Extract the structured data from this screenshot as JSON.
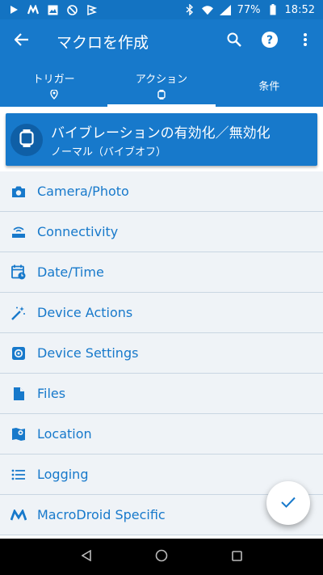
{
  "status_bar": {
    "battery": "77%",
    "time": "18:52",
    "icons_left": [
      "play-icon",
      "macrodroid-icon",
      "image-icon",
      "dnd-icon",
      "vpn-key-icon"
    ],
    "icons_right": [
      "bluetooth-icon",
      "wifi-icon",
      "signal-icon",
      "battery-icon"
    ]
  },
  "app_bar": {
    "title": "マクロを作成",
    "actions": [
      "search-icon",
      "help-icon",
      "more-vert-icon"
    ]
  },
  "tabs": [
    {
      "label": "トリガー",
      "icon": "trigger-icon"
    },
    {
      "label": "アクション",
      "icon": "watch-icon",
      "active": true
    },
    {
      "label": "条件"
    }
  ],
  "selected_action": {
    "title": "バイブレーションの有効化／無効化",
    "subtitle": "ノーマル（バイブオフ）",
    "icon": "watch-icon"
  },
  "categories": [
    {
      "label": "Camera/Photo",
      "icon": "camera-icon"
    },
    {
      "label": "Connectivity",
      "icon": "router-icon"
    },
    {
      "label": "Date/Time",
      "icon": "calendar-clock-icon"
    },
    {
      "label": "Device Actions",
      "icon": "magic-wand-icon"
    },
    {
      "label": "Device Settings",
      "icon": "settings-gear-icon"
    },
    {
      "label": "Files",
      "icon": "file-icon"
    },
    {
      "label": "Location",
      "icon": "map-pin-icon"
    },
    {
      "label": "Logging",
      "icon": "list-icon"
    },
    {
      "label": "MacroDroid Specific",
      "icon": "macrodroid-m-icon"
    }
  ],
  "fab": {
    "icon": "check-icon"
  },
  "nav": [
    "back-triangle-icon",
    "home-circle-icon",
    "recents-square-icon"
  ],
  "colors": {
    "primary": "#1779cb",
    "statusbar": "#1373c2",
    "list_bg": "#eff3f7"
  }
}
